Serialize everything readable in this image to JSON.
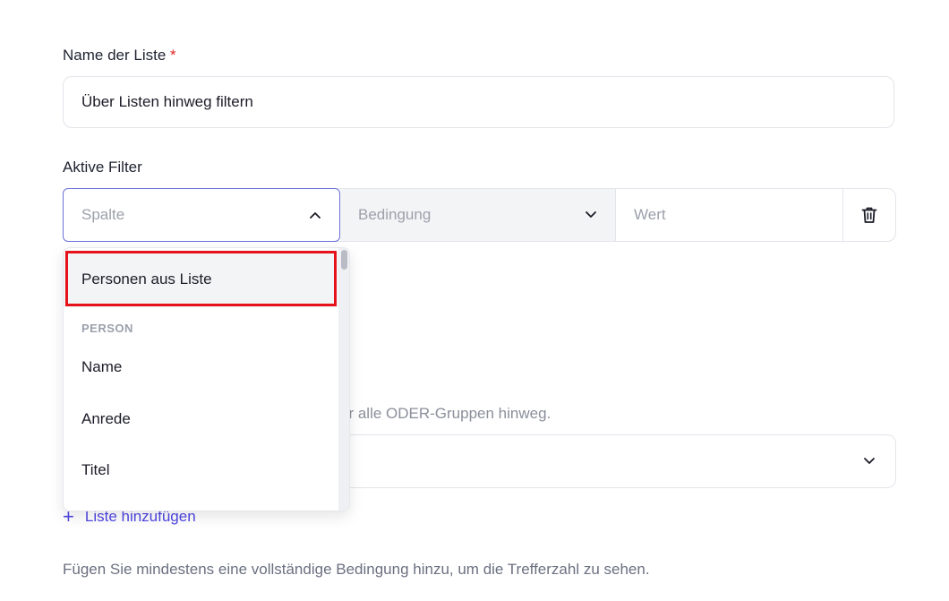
{
  "form": {
    "list_name_label": "Name der Liste",
    "required_mark": "*",
    "list_name_value": "Über Listen hinweg filtern",
    "active_filters_label": "Aktive Filter"
  },
  "filter": {
    "column_placeholder": "Spalte",
    "condition_placeholder": "Bedingung",
    "value_placeholder": "Wert"
  },
  "dropdown": {
    "highlighted_item": "Personen aus Liste",
    "group_label": "PERSON",
    "items": [
      "Name",
      "Anrede",
      "Titel"
    ]
  },
  "lists": {
    "hint_partial": "er alle ODER-Gruppen hinweg.",
    "add_list_icon": "+",
    "add_list_label": "Liste hinzufügen"
  },
  "footer": {
    "hint": "Fügen Sie mindestens eine vollständige Bedingung hinzu, um die Trefferzahl zu sehen."
  },
  "icons": {
    "column_chevron": "chevron-up-icon",
    "condition_chevron": "chevron-down-icon",
    "delete": "trash-icon",
    "select_chevron": "chevron-down-icon"
  },
  "colors": {
    "accent": "#4f46e5",
    "focus_border": "#6b72d6",
    "annotation_box": "#e5121b",
    "required": "#dc2626"
  }
}
